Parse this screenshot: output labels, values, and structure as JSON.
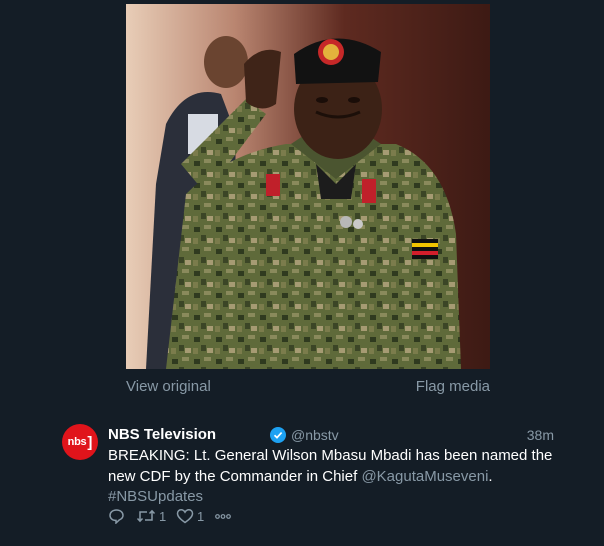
{
  "media": {
    "view_original": "View original",
    "flag_media": "Flag media"
  },
  "tweet": {
    "avatar_label": "nbs",
    "display_name": "NBS Television",
    "verified": true,
    "handle": "@nbstv",
    "time": "38m",
    "text_before": "BREAKING: Lt. General Wilson Mbasu Mbadi has been named the new CDF by the Commander in Chief ",
    "mention": "@KagutaMuseveni",
    "text_after": ".",
    "hashtag": "#NBSUpdates",
    "actions": {
      "reply_count": "",
      "retweet_count": "1",
      "like_count": "1"
    }
  },
  "colors": {
    "background": "#141d26",
    "muted": "#8899a6",
    "verified": "#1da1f2",
    "brand": "#e0141b"
  }
}
